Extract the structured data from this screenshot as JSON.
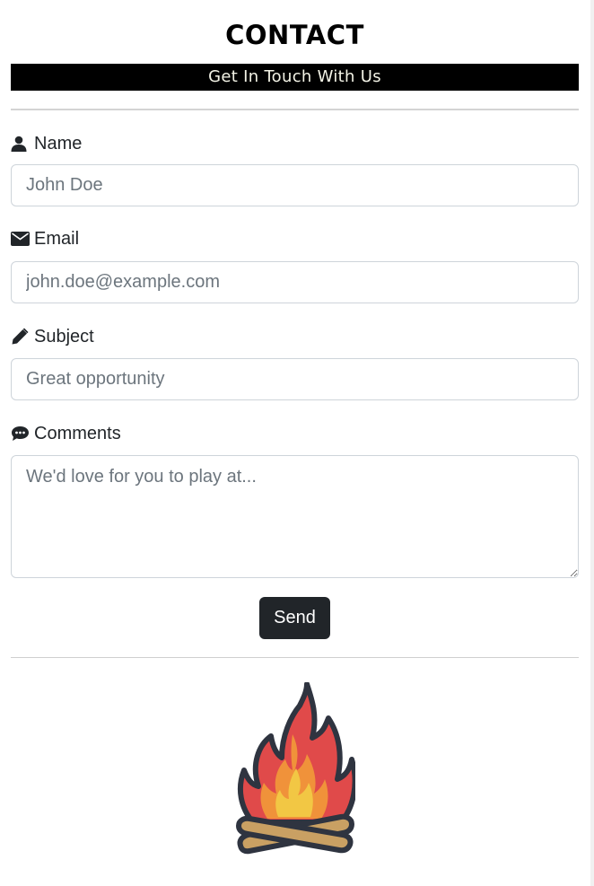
{
  "page": {
    "title": "CONTACT",
    "subtitle": "Get In Touch With Us"
  },
  "form": {
    "name": {
      "label": "Name",
      "placeholder": "John Doe",
      "icon": "user-icon"
    },
    "email": {
      "label": "Email",
      "placeholder": "john.doe@example.com",
      "icon": "envelope-icon"
    },
    "subject": {
      "label": "Subject",
      "placeholder": "Great opportunity",
      "icon": "pencil-icon"
    },
    "comments": {
      "label": "Comments",
      "placeholder": "We'd love for you to play at...",
      "icon": "speech-bubble-icon"
    },
    "send_label": "Send"
  },
  "logo": {
    "icon": "campfire-icon"
  },
  "colors": {
    "banner_bg": "#000000",
    "banner_text": "#f3f3e6",
    "button_bg": "#212529",
    "fire_red": "#e04a4a",
    "fire_orange": "#f0923a",
    "fire_yellow": "#f2c744",
    "wood": "#c9a063",
    "outline": "#2f3440"
  }
}
